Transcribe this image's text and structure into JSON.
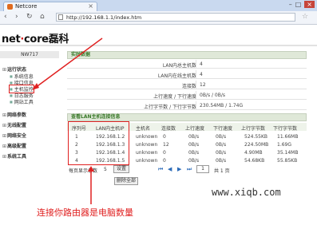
{
  "browser": {
    "tab_title": "Netcore",
    "url": "http://192.168.1.1/index.htm"
  },
  "logo": {
    "net": "net",
    "dot": "·",
    "core": "core",
    "cn": "磊科"
  },
  "sidebar": {
    "model": "NW717",
    "groups": [
      {
        "label": "运行状态",
        "items": [
          "系统信息",
          "接口信息",
          "主机监控",
          "日志服务",
          "网站工具"
        ]
      },
      {
        "label": "网络参数"
      },
      {
        "label": "无线配置"
      },
      {
        "label": "网络安全"
      },
      {
        "label": "高级配置"
      },
      {
        "label": "系统工具"
      }
    ]
  },
  "realtime": {
    "title": "实时数据",
    "rows": [
      {
        "label": "LAN内总主机数",
        "value": "4"
      },
      {
        "label": "LAN内在线主机数",
        "value": "4"
      },
      {
        "label": "连接数",
        "value": "12"
      },
      {
        "label": "上行速度 / 下行速度",
        "value": "0B/s / 0B/s"
      },
      {
        "label": "上行字节数 / 下行字节数",
        "value": "230.54MB / 1.74G"
      }
    ]
  },
  "hosts": {
    "title": "查看LAN主机连接信息",
    "columns": [
      "序列号",
      "LAN内主机IP",
      "主机名",
      "连接数",
      "上行速度",
      "下行速度",
      "上行字节数",
      "下行字节数"
    ],
    "rows": [
      [
        "1",
        "192.168.1.2",
        "unknown",
        "0",
        "0B/s",
        "0B/s",
        "524.55KB",
        "11.66MB"
      ],
      [
        "2",
        "192.168.1.3",
        "unknown",
        "12",
        "0B/s",
        "0B/s",
        "224.50MB",
        "1.69G"
      ],
      [
        "3",
        "192.168.1.4",
        "unknown",
        "0",
        "0B/s",
        "0B/s",
        "4.90MB",
        "35.14MB"
      ],
      [
        "4",
        "192.168.1.5",
        "unknown",
        "0",
        "0B/s",
        "0B/s",
        "54.68KB",
        "55.85KB"
      ]
    ]
  },
  "pager": {
    "per_page_label": "每页显示条数",
    "per_page_value": "5",
    "set_label": "设置",
    "page_value": "1",
    "total": "共 1 页",
    "delete_all": "删除全部"
  },
  "annotation": {
    "caption": "连接你路由器是电脑数量",
    "watermark": "www.xiqb.com",
    "color": "#e02020"
  }
}
